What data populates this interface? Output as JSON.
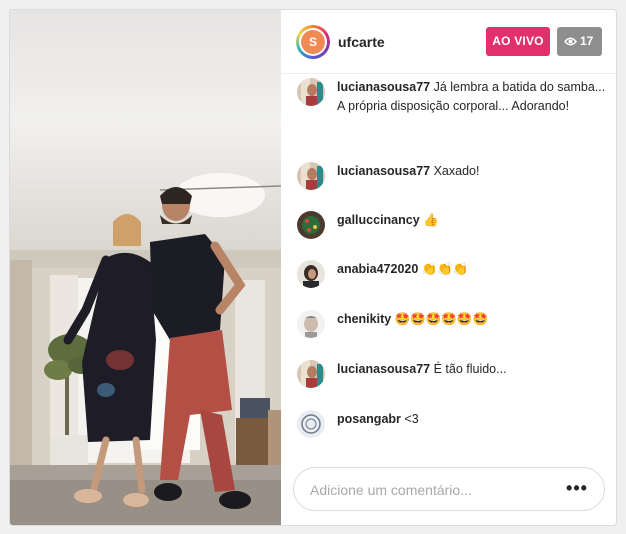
{
  "header": {
    "avatar_initial": "S",
    "username": "ufcarte",
    "live_label": "AO VIVO",
    "viewer_count": "17"
  },
  "comments": [
    {
      "user": "lucianasousa77",
      "text": "Já lembra a batida do samba... A própria disposição corporal... Adorando!"
    },
    {
      "user": "lucianasousa77",
      "text": "Xaxado!"
    },
    {
      "user": "galluccinancy",
      "text": "👍"
    },
    {
      "user": "anabia472020",
      "text": "👏👏👏"
    },
    {
      "user": "chenikity",
      "text": "🤩🤩🤩🤩🤩🤩"
    },
    {
      "user": "lucianasousa77",
      "text": "É tão fluido..."
    },
    {
      "user": "posangabr",
      "text": "<3"
    }
  ],
  "composer": {
    "placeholder": "Adicione um comentário...",
    "more_label": "•••"
  },
  "colors": {
    "live": "#e1306c",
    "viewer_badge": "#8e8e8e",
    "text": "#262626"
  }
}
